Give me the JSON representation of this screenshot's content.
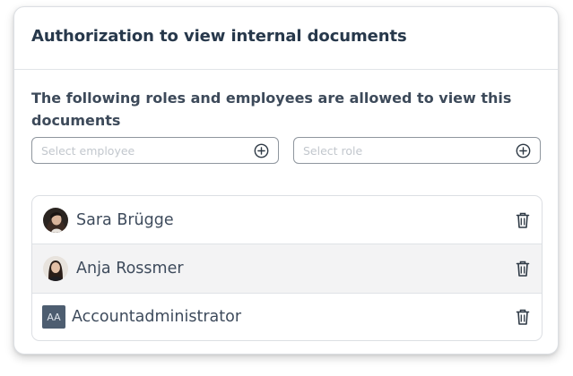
{
  "card": {
    "title": "Authorization to view internal documents",
    "description": "The following roles and employees are allowed to view this documents"
  },
  "employee_select": {
    "placeholder": "Select employee",
    "icon": "plus-circle-icon"
  },
  "role_select": {
    "placeholder": "Select role",
    "icon": "plus-circle-icon"
  },
  "members": [
    {
      "label": "Sara Brügge",
      "avatar": "photo",
      "icon": "trash-icon"
    },
    {
      "label": "Anja Rossmer",
      "avatar": "photo",
      "icon": "trash-icon"
    },
    {
      "label": "Accountadministrator",
      "avatar_initials": "AA",
      "icon": "trash-icon"
    }
  ],
  "colors": {
    "title": "#27384b",
    "text": "#3e4b5c",
    "role_avatar": "#4d5d70",
    "alt_row": "#f3f3f4"
  }
}
